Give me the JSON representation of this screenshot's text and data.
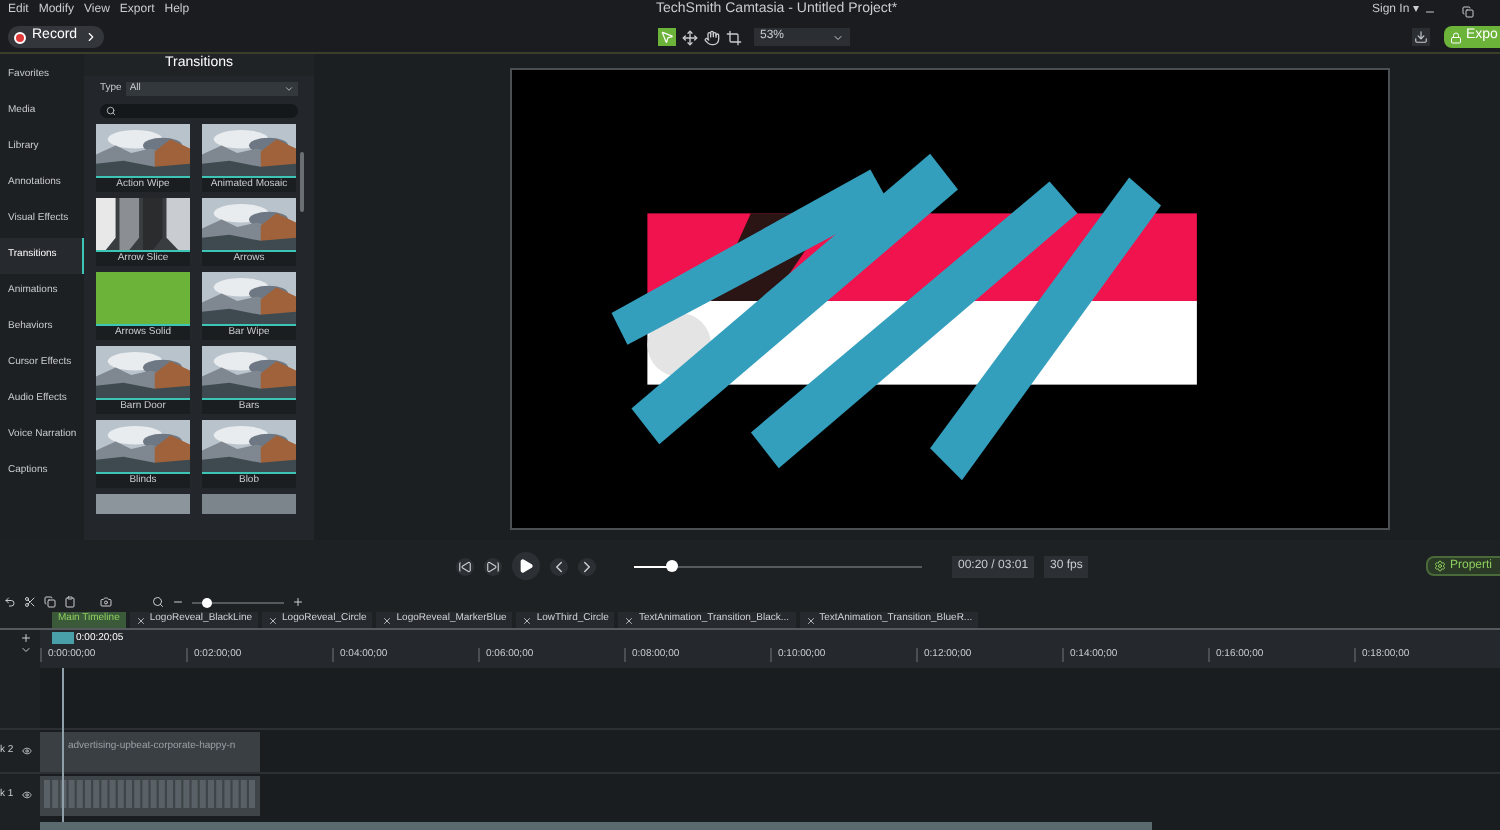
{
  "menu": [
    "Edit",
    "Modify",
    "View",
    "Export",
    "Help"
  ],
  "window": {
    "title": "TechSmith Camtasia - Untitled Project*",
    "sign_in": "Sign In ▾"
  },
  "toolbar": {
    "record": "Record",
    "zoom": "53%",
    "export": "Expo"
  },
  "sidebar": {
    "items": [
      {
        "label": "Favorites",
        "selected": false
      },
      {
        "label": "Media",
        "selected": false
      },
      {
        "label": "Library",
        "selected": false
      },
      {
        "label": "Annotations",
        "selected": false
      },
      {
        "label": "Visual Effects",
        "selected": false
      },
      {
        "label": "Transitions",
        "selected": true
      },
      {
        "label": "Animations",
        "selected": false
      },
      {
        "label": "Behaviors",
        "selected": false
      },
      {
        "label": "Cursor Effects",
        "selected": false
      },
      {
        "label": "Audio Effects",
        "selected": false
      },
      {
        "label": "Voice Narration",
        "selected": false
      },
      {
        "label": "Captions",
        "selected": false
      }
    ]
  },
  "panel": {
    "title": "Transitions",
    "type_label": "Type",
    "type_value": "All",
    "items": [
      {
        "label": "Action Wipe",
        "kind": "picture"
      },
      {
        "label": "Animated Mosaic",
        "kind": "picture"
      },
      {
        "label": "Arrow Slice",
        "kind": "slices"
      },
      {
        "label": "Arrows",
        "kind": "picture"
      },
      {
        "label": "Arrows Solid",
        "kind": "solid"
      },
      {
        "label": "Bar Wipe",
        "kind": "picture"
      },
      {
        "label": "Barn Door",
        "kind": "picture"
      },
      {
        "label": "Bars",
        "kind": "picture"
      },
      {
        "label": "Blinds",
        "kind": "picture"
      },
      {
        "label": "Blob",
        "kind": "picture"
      }
    ]
  },
  "playback": {
    "time": "00:20 / 03:01",
    "fps": "30 fps",
    "level": 0.13,
    "properties": "Properti"
  },
  "timeline": {
    "zoom": {
      "level": 0.15
    },
    "tabs": [
      {
        "label": "Main Timeline",
        "selected": true
      },
      {
        "label": "LogoReveal_BlackLine",
        "selected": false
      },
      {
        "label": "LogoReveal_Circle",
        "selected": false
      },
      {
        "label": "LogoReveal_MarkerBlue",
        "selected": false
      },
      {
        "label": "LowThird_Circle",
        "selected": false
      },
      {
        "label": "TextAnimation_Transition_Black...",
        "selected": false
      },
      {
        "label": "TextAnimation_Transition_BlueR...",
        "selected": false
      }
    ],
    "playhead": "0:00:20;05",
    "ticks": [
      "0:00:00;00",
      "0:02:00;00",
      "0:04:00;00",
      "0:06:00;00",
      "0:08:00;00",
      "0:10:00;00",
      "0:12:00;00",
      "0:14:00;00",
      "0:16:00;00",
      "0:18:00;00"
    ],
    "tracks": [
      {
        "label": "k 2",
        "kind": "audio",
        "clip": "advertising-upbeat-corporate-happy-n"
      },
      {
        "label": "k 1",
        "kind": "media"
      }
    ]
  }
}
